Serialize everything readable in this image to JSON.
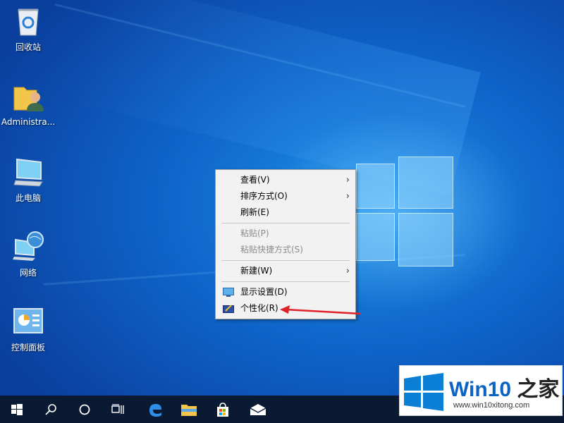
{
  "desktop_icons": [
    {
      "name": "recycle-bin",
      "label": "回收站"
    },
    {
      "name": "user-folder",
      "label": "Administra..."
    },
    {
      "name": "this-pc",
      "label": "此电脑"
    },
    {
      "name": "network",
      "label": "网络"
    },
    {
      "name": "control-panel",
      "label": "控制面板"
    }
  ],
  "context_menu": {
    "view": "查看(V)",
    "sort": "排序方式(O)",
    "refresh": "刷新(E)",
    "paste": "粘贴(P)",
    "paste_shortcut": "粘贴快捷方式(S)",
    "new": "新建(W)",
    "display": "显示设置(D)",
    "personalize": "个性化(R)",
    "submenu_arrow": "›"
  },
  "taskbar": {
    "icons": [
      "windows-start-icon",
      "search-icon",
      "cortana-icon",
      "task-view-icon",
      "edge-icon",
      "file-explorer-icon",
      "store-icon",
      "mail-icon"
    ]
  },
  "watermark": {
    "title_blue": "Win10",
    "title_dark": " 之家",
    "url": "www.win10xitong.com"
  },
  "colors": {
    "accent_red": "#e0202a",
    "brand_blue": "#0b63c5",
    "taskbar_bg": "#0a1a33"
  }
}
